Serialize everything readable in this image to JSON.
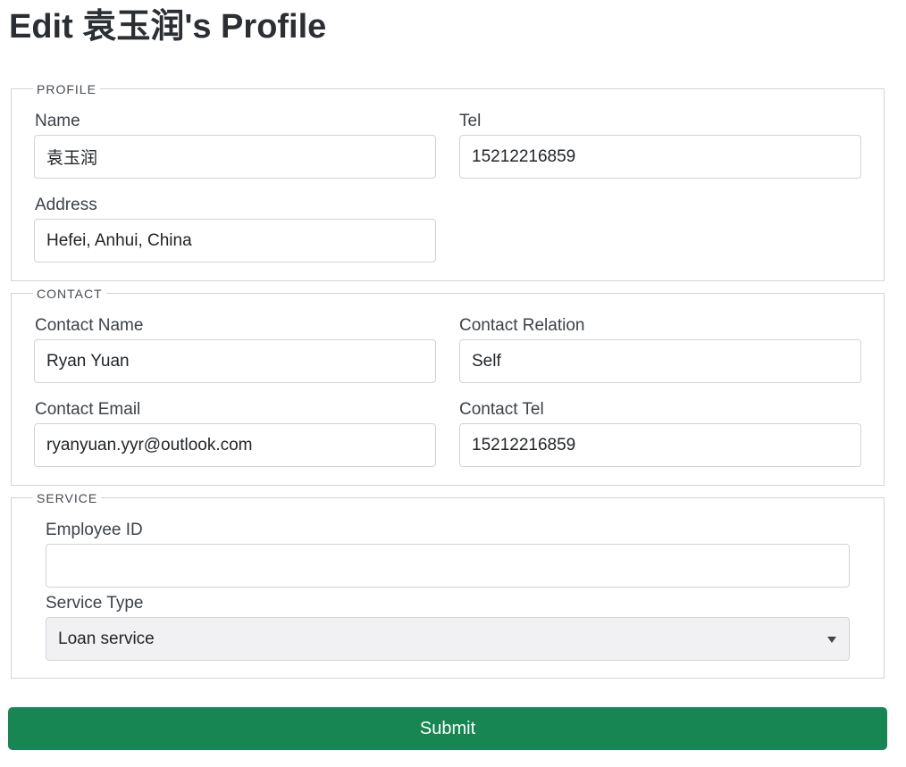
{
  "page": {
    "title": "Edit 袁玉润's Profile"
  },
  "profile": {
    "legend": "PROFILE",
    "name_label": "Name",
    "name_value": "袁玉润",
    "tel_label": "Tel",
    "tel_value": "15212216859",
    "address_label": "Address",
    "address_value": "Hefei, Anhui, China"
  },
  "contact": {
    "legend": "CONTACT",
    "name_label": "Contact Name",
    "name_value": "Ryan Yuan",
    "relation_label": "Contact Relation",
    "relation_value": "Self",
    "email_label": "Contact Email",
    "email_value": "ryanyuan.yyr@outlook.com",
    "tel_label": "Contact Tel",
    "tel_value": "15212216859"
  },
  "service": {
    "legend": "SERVICE",
    "employee_id_label": "Employee ID",
    "employee_id_value": "",
    "service_type_label": "Service Type",
    "service_type_selected": "Loan service"
  },
  "actions": {
    "submit_label": "Submit"
  },
  "colors": {
    "submit_bg": "#178652",
    "border": "#ced4da",
    "select_bg": "#f1f1f3"
  }
}
